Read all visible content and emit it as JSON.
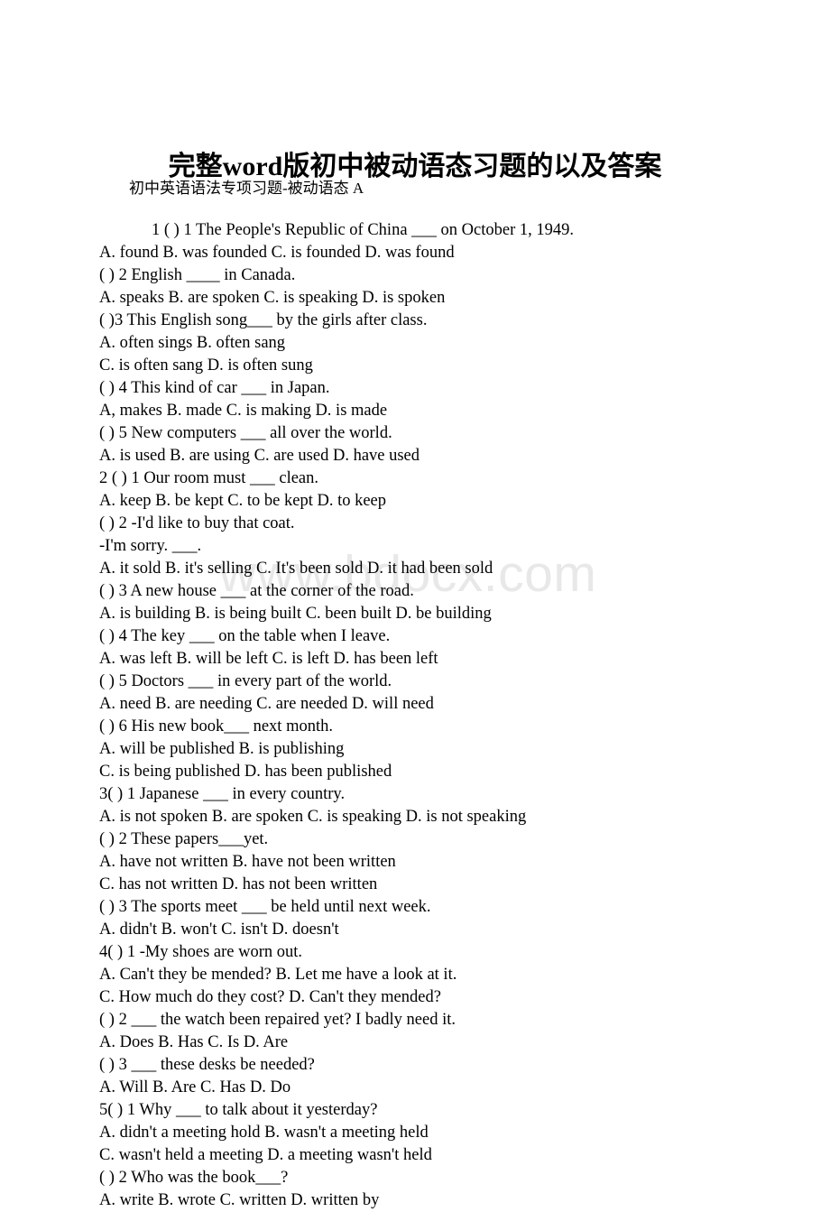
{
  "document": {
    "title": "完整word版初中被动语态习题的以及答案",
    "subtitle": "初中英语语法专项习题-被动语态 A",
    "watermark": "www.bdocx.com",
    "watermark_color": "#e8e8e8",
    "text_color": "#000000",
    "background_color": "#ffffff"
  },
  "body_lines": [
    {
      "text": "1 ( ) 1 The People's Republic of China ___ on October 1, 1949.",
      "indent": true
    },
    {
      "text": "A. found B. was founded C. is founded D. was found",
      "indent": false
    },
    {
      "text": "( ) 2 English ____ in Canada.",
      "indent": false
    },
    {
      "text": "A. speaks B. are spoken C. is speaking D. is spoken",
      "indent": false
    },
    {
      "text": "( )3 This English song___ by the girls after class.",
      "indent": false
    },
    {
      "text": "A. often sings B. often sang",
      "indent": false
    },
    {
      "text": "C. is often sang D. is often sung",
      "indent": false
    },
    {
      "text": "( ) 4 This kind of car ___ in Japan.",
      "indent": false
    },
    {
      "text": "A, makes B. made C. is making D. is made",
      "indent": false
    },
    {
      "text": "( ) 5 New computers ___ all over the world.",
      "indent": false
    },
    {
      "text": "A. is used B. are using C. are used D. have used",
      "indent": false
    },
    {
      "text": "2 ( ) 1 Our room must ___ clean.",
      "indent": false
    },
    {
      "text": "A. keep B. be kept C. to be kept D. to keep",
      "indent": false
    },
    {
      "text": "( ) 2 -I'd like to buy that coat.",
      "indent": false
    },
    {
      "text": "-I'm sorry. ___.",
      "indent": false
    },
    {
      "text": "A. it sold B. it's selling C. It's been sold D. it had been sold",
      "indent": false
    },
    {
      "text": "( ) 3 A new house ___ at the corner of the road.",
      "indent": false
    },
    {
      "text": "A. is building B. is being built C. been built D. be building",
      "indent": false
    },
    {
      "text": "( ) 4 The key ___ on the table when I leave.",
      "indent": false
    },
    {
      "text": "A. was left B. will be left C. is left D. has been left",
      "indent": false
    },
    {
      "text": "( ) 5 Doctors ___ in every part of the world.",
      "indent": false
    },
    {
      "text": "A. need B. are needing C. are needed D. will need",
      "indent": false
    },
    {
      "text": "( ) 6 His new book___ next month.",
      "indent": false
    },
    {
      "text": "A. will be published B. is publishing",
      "indent": false
    },
    {
      "text": "C. is being published D. has been published",
      "indent": false
    },
    {
      "text": "3( ) 1 Japanese ___ in every country.",
      "indent": false
    },
    {
      "text": "A. is not spoken B. are spoken C. is speaking D. is not speaking",
      "indent": false
    },
    {
      "text": "( ) 2 These papers___yet.",
      "indent": false
    },
    {
      "text": "A. have not written B. have not been written",
      "indent": false
    },
    {
      "text": "C. has not written D. has not been written",
      "indent": false
    },
    {
      "text": "( ) 3 The sports meet ___ be held until next week.",
      "indent": false
    },
    {
      "text": "A. didn't B. won't C. isn't D. doesn't",
      "indent": false
    },
    {
      "text": "4( ) 1 -My shoes are worn out.",
      "indent": false
    },
    {
      "text": "A. Can't they be mended? B. Let me have a look at it.",
      "indent": false
    },
    {
      "text": "C. How much do they cost? D. Can't they mended?",
      "indent": false
    },
    {
      "text": "( ) 2 ___ the watch been repaired yet? I badly need it.",
      "indent": false
    },
    {
      "text": "A. Does B. Has C. Is D. Are",
      "indent": false
    },
    {
      "text": "( ) 3 ___ these desks be needed?",
      "indent": false
    },
    {
      "text": "A. Will B. Are C. Has D. Do",
      "indent": false
    },
    {
      "text": "5( ) 1 Why ___ to talk about it yesterday?",
      "indent": false
    },
    {
      "text": "A. didn't a meeting hold B. wasn't a meeting held",
      "indent": false
    },
    {
      "text": "C. wasn't held a meeting D. a meeting wasn't held",
      "indent": false
    },
    {
      "text": "( ) 2 Who was the book___?",
      "indent": false
    },
    {
      "text": "A. write B. wrote C. written D. written by",
      "indent": false
    }
  ]
}
